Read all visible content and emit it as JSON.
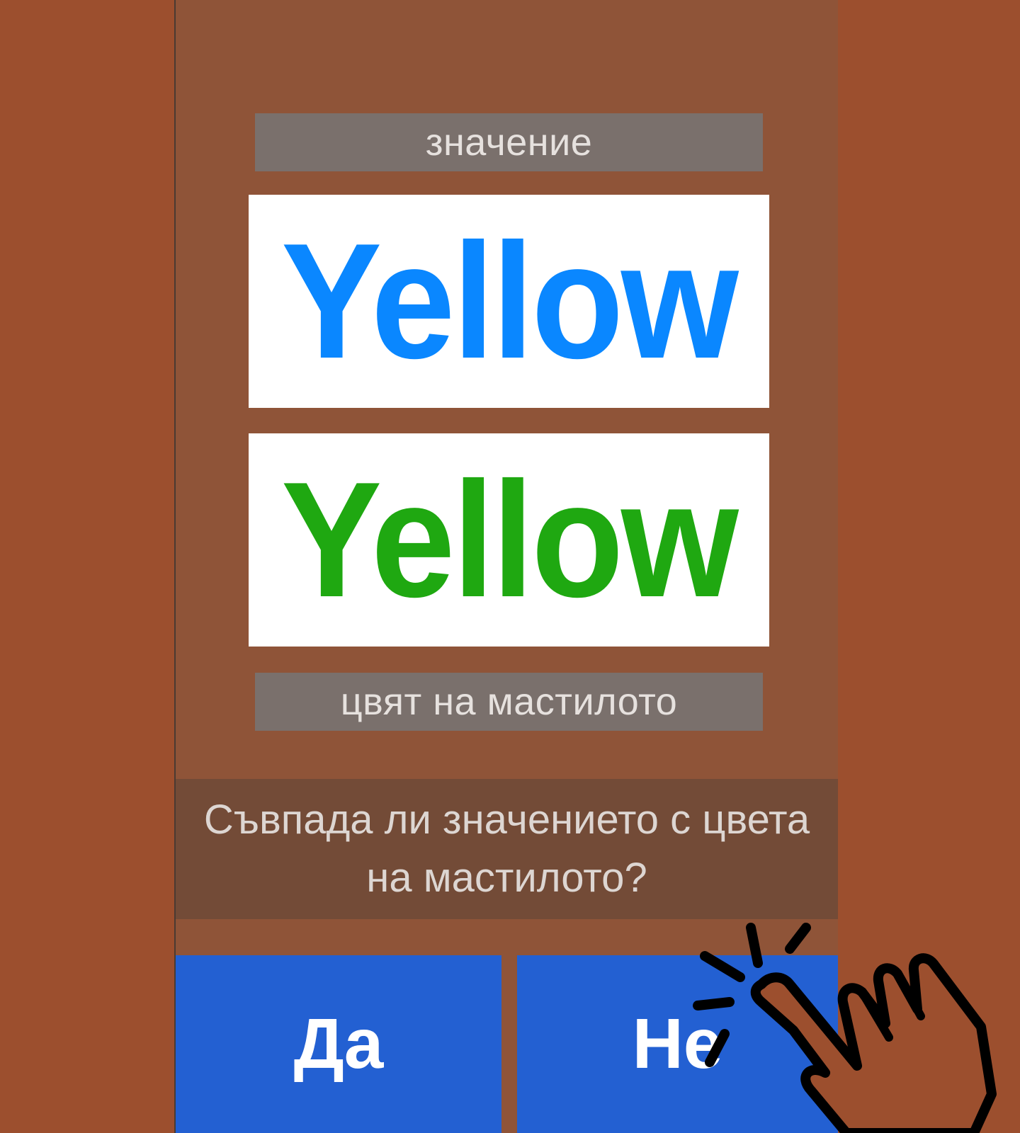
{
  "meaning_label": "значение",
  "top_word": {
    "text": "Yellow",
    "color": "#0a87ff"
  },
  "bottom_word": {
    "text": "Yellow",
    "color": "#1fa811"
  },
  "ink_color_label": "цвят на мастилото",
  "question": "Съвпада ли значението с цвета на мастилото?",
  "buttons": {
    "yes_label": "Да",
    "no_label": "Не"
  },
  "colors": {
    "background": "#9c4f2e",
    "panel": "#8f5438",
    "label_bar": "#7a706c",
    "question_bar": "#734b37",
    "button": "#2360d2"
  },
  "icons": {
    "tap_hint": "tap-hand-icon"
  }
}
